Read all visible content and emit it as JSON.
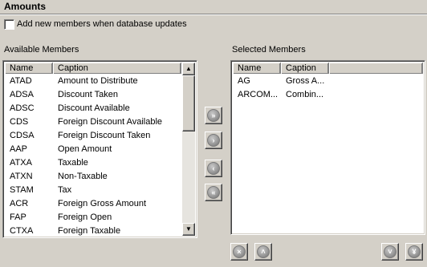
{
  "section_title": "Amounts",
  "add_members_checkbox": {
    "label": "Add new members when database updates",
    "checked": false
  },
  "available": {
    "label": "Available Members",
    "columns": [
      "Name",
      "Caption"
    ],
    "rows": [
      [
        "ATAD",
        "Amount to Distribute"
      ],
      [
        "ADSA",
        "Discount Taken"
      ],
      [
        "ADSC",
        "Discount Available"
      ],
      [
        "CDS",
        "Foreign Discount Available"
      ],
      [
        "CDSA",
        "Foreign Discount Taken"
      ],
      [
        "AAP",
        "Open Amount"
      ],
      [
        "ATXA",
        "Taxable"
      ],
      [
        "ATXN",
        "Non-Taxable"
      ],
      [
        "STAM",
        "Tax"
      ],
      [
        "ACR",
        "Foreign Gross Amount"
      ],
      [
        "FAP",
        "Foreign Open"
      ],
      [
        "CTXA",
        "Foreign Taxable"
      ]
    ]
  },
  "selected": {
    "label": "Selected Members",
    "columns": [
      "Name",
      "Caption"
    ],
    "rows": [
      [
        "AG",
        "Gross A..."
      ],
      [
        "ARCOM...",
        "Combin..."
      ]
    ]
  },
  "icons": {
    "scroll_up": "arrow-up-icon",
    "scroll_down": "arrow-down-icon",
    "add_all": "double-chevron-right-icon",
    "add": "chevron-right-icon",
    "remove": "chevron-left-icon",
    "remove_all": "double-chevron-left-icon",
    "move_top": "close-circle-icon",
    "move_up": "chevron-up-icon",
    "move_down": "chevron-down-icon",
    "move_bottom": "double-chevron-down-icon"
  }
}
